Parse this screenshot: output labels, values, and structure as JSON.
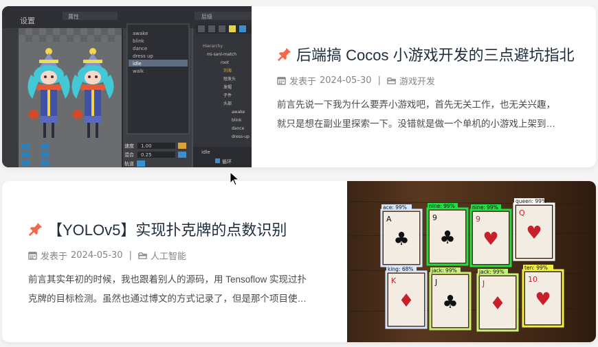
{
  "posts": [
    {
      "title": "后端搞 Cocos 小游戏开发的三点避坑指北",
      "meta_prefix": "发表于",
      "date": "2024-05-30",
      "category": "游戏开发",
      "excerpt_line1": "前言先说一下我为什么要弄小游戏吧，首先无关工作，也无关兴趣，",
      "excerpt_line2": "就只是想在副业里探索一下。没错就是做一个单机的小游戏上架到…",
      "cover": {
        "top_label": "设置",
        "panel_title": "属性",
        "tab_label": "层级",
        "anim_list": [
          "awake",
          "blink",
          "dance",
          "dress up",
          "idle",
          "walk"
        ],
        "tree_items": [
          "Hierarchy",
          "mi-sanl-match",
          "root",
          "刘海",
          "短发头",
          "发帽",
          "子件",
          "头部",
          "awake",
          "blink",
          "dance",
          "dress-up"
        ],
        "field_labels": [
          "速度",
          "混合",
          "轨道"
        ],
        "field_values": [
          "1.00",
          "0.25"
        ],
        "footer_left": "idle",
        "footer_check": "循环"
      }
    },
    {
      "title": "【YOLOv5】实现扑克牌的点数识别",
      "meta_prefix": "发表于",
      "date": "2024-05-30",
      "category": "人工智能",
      "excerpt_line1": "前言其实年初的时候，我也跟着别人的源码，用 Tensoflow 实现过扑",
      "excerpt_line2": "克牌的目标检测。虽然也通过博文的方式记录了，但是那个项目使…",
      "cover": {
        "detections": [
          {
            "label": "ace: 99%",
            "rank": "A",
            "suit": "♣",
            "color": "#d6e7ff"
          },
          {
            "label": "nine: 99%",
            "rank": "9",
            "suit": "♣",
            "color": "#22dd44"
          },
          {
            "label": "nine: 99%",
            "rank": "9",
            "suit": "♥",
            "color": "#22dd44"
          },
          {
            "label": "queen: 99%",
            "rank": "Q",
            "suit": "♥",
            "color": "#ffffff"
          },
          {
            "label": "king: 68%",
            "rank": "K",
            "suit": "♦",
            "color": "#d6e7ff"
          },
          {
            "label": "jack: 99%",
            "rank": "J",
            "suit": "♣",
            "color": "#c6f27a"
          },
          {
            "label": "jack: 99%",
            "rank": "J",
            "suit": "♦",
            "color": "#c6f27a"
          },
          {
            "label": "ten: 99%",
            "rank": "10",
            "suit": "♥",
            "color": "#f0f040"
          }
        ]
      }
    }
  ],
  "colors": {
    "pin": "#f2694a",
    "title": "#1f2d3d",
    "meta": "#858585",
    "excerpt": "#4c4948"
  }
}
